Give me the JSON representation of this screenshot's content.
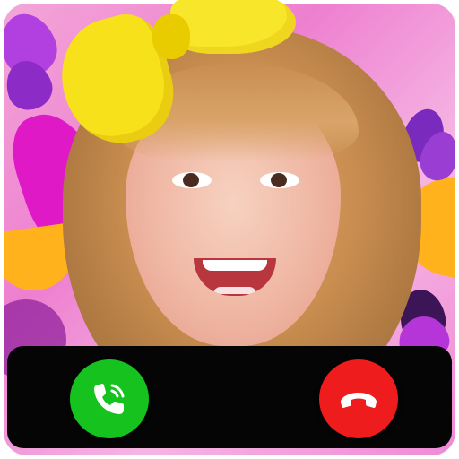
{
  "app": {
    "accent_background": "#f08ad6",
    "bow_color": "#f7e11b",
    "call_bar_color": "#050505"
  },
  "call_controls": {
    "answer": {
      "icon": "phone-ringing-icon",
      "color": "#16c31e"
    },
    "decline": {
      "icon": "phone-hangup-icon",
      "color": "#ee1c1c"
    }
  }
}
